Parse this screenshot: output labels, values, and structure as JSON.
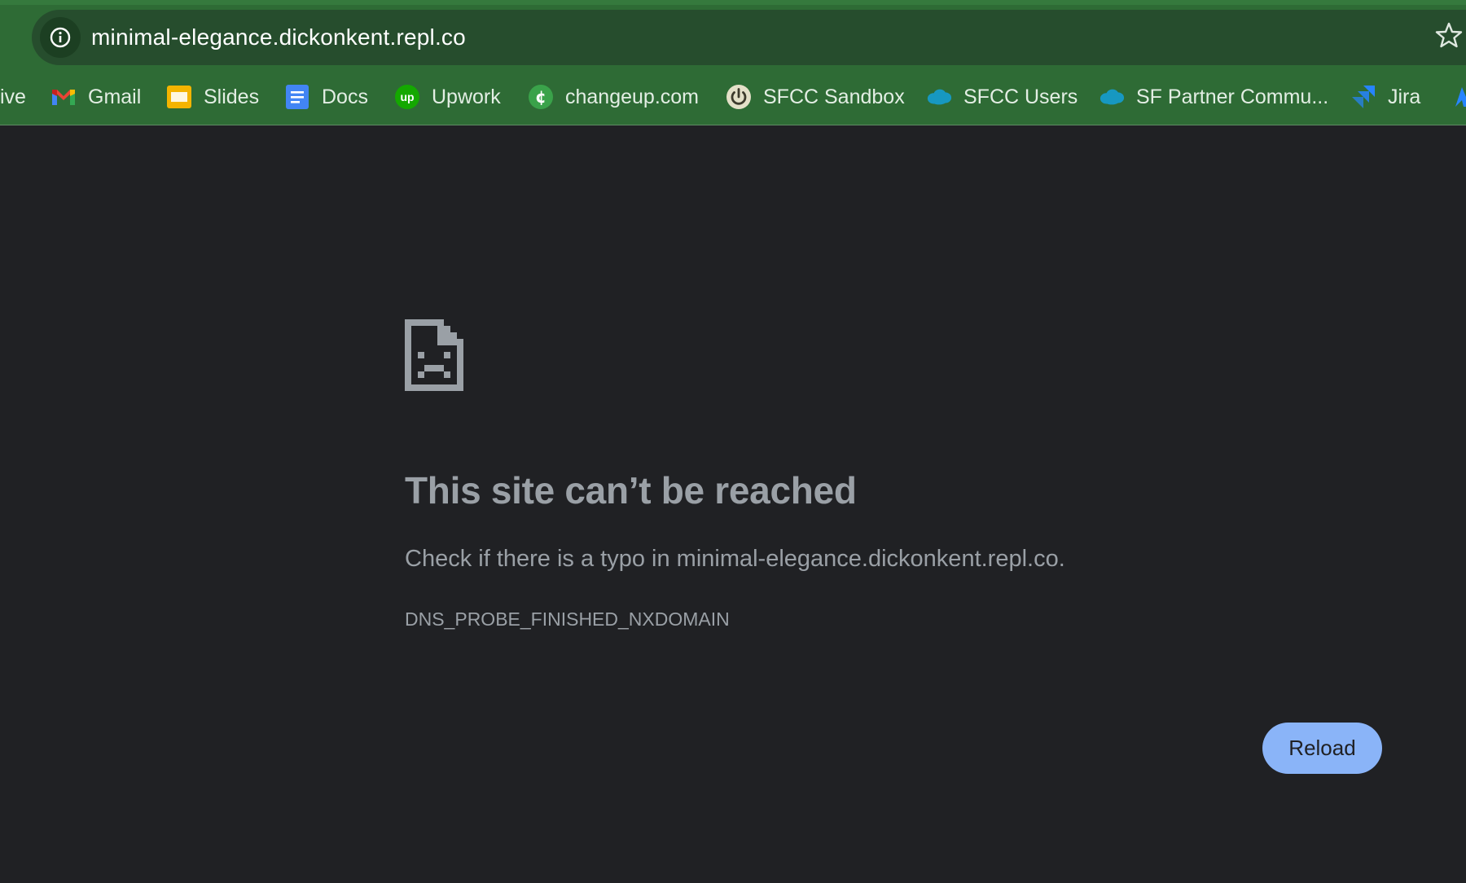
{
  "browser": {
    "url": "minimal-elegance.dickonkent.repl.co",
    "site_info_icon": "info-icon",
    "bookmark_star_icon": "star-icon"
  },
  "bookmarks": [
    {
      "label": "ive",
      "icon": "drive-icon"
    },
    {
      "label": "Gmail",
      "icon": "gmail-icon"
    },
    {
      "label": "Slides",
      "icon": "slides-icon"
    },
    {
      "label": "Docs",
      "icon": "docs-icon"
    },
    {
      "label": "Upwork",
      "icon": "upwork-icon"
    },
    {
      "label": "changeup.com",
      "icon": "changeup-icon"
    },
    {
      "label": "SFCC Sandbox",
      "icon": "power-icon"
    },
    {
      "label": "SFCC Users",
      "icon": "salesforce-cloud-icon"
    },
    {
      "label": "SF Partner Commu...",
      "icon": "salesforce-cloud-icon"
    },
    {
      "label": "Jira",
      "icon": "jira-icon"
    },
    {
      "label": "",
      "icon": "atlassian-icon"
    }
  ],
  "error": {
    "icon": "sad-file-icon",
    "title": "This site can’t be reached",
    "message": "Check if there is a typo in minimal-elegance.dickonkent.repl.co.",
    "code": "DNS_PROBE_FINISHED_NXDOMAIN",
    "reload_label": "Reload"
  },
  "colors": {
    "chrome_green": "#2e6b35",
    "omnibox": "#264d2d",
    "page_bg": "#202124",
    "text_muted": "#9aa0a6",
    "button_blue": "#8ab4f8"
  }
}
